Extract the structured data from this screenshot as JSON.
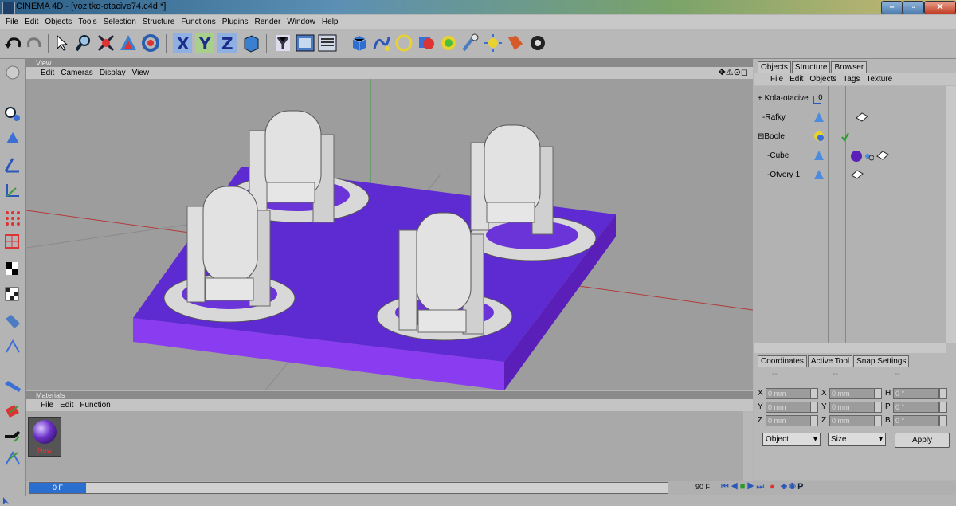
{
  "window": {
    "title": "CINEMA 4D - [vozitko-otacive74.c4d *]",
    "minimize": "–",
    "maximize": "▫",
    "close": "✕"
  },
  "menubar": [
    "File",
    "Edit",
    "Objects",
    "Tools",
    "Selection",
    "Structure",
    "Functions",
    "Plugins",
    "Render",
    "Window",
    "Help"
  ],
  "viewport": {
    "panel_title": "View",
    "menu": [
      "Edit",
      "Cameras",
      "Display",
      "View"
    ],
    "nav_icons": "✥⚠⊙◻"
  },
  "materials": {
    "panel_title": "Materials",
    "menu": [
      "File",
      "Edit",
      "Function"
    ],
    "new_material_label": "New",
    "material_color": "#6a2fc8"
  },
  "objects_panel": {
    "tabs": [
      "Objects",
      "Structure",
      "Browser"
    ],
    "menu": [
      "File",
      "Edit",
      "Objects",
      "Tags",
      "Texture"
    ],
    "tree": [
      {
        "name": "Kola-otacive",
        "prefix": "+"
      },
      {
        "name": "Rafky",
        "prefix": "-"
      },
      {
        "name": "Boole",
        "prefix": "⊟"
      },
      {
        "name": "Cube",
        "prefix": "-"
      },
      {
        "name": "Otvory 1",
        "prefix": "-"
      }
    ]
  },
  "coordinates_panel": {
    "tabs": [
      "Coordinates",
      "Active Tool",
      "Snap Settings"
    ],
    "col_headers": [
      "--",
      "--",
      "--"
    ],
    "rows": [
      {
        "pos_label": "X",
        "pos_value": "0 mm",
        "size_label": "X",
        "size_value": "0 mm",
        "rot_label": "H",
        "rot_value": "0 °"
      },
      {
        "pos_label": "Y",
        "pos_value": "0 mm",
        "size_label": "Y",
        "size_value": "0 mm",
        "rot_label": "P",
        "rot_value": "0 °"
      },
      {
        "pos_label": "Z",
        "pos_value": "0 mm",
        "size_label": "Z",
        "size_value": "0 mm",
        "rot_label": "B",
        "rot_value": "0 °"
      }
    ],
    "mode_select": "Object",
    "size_select": "Size",
    "apply_label": "Apply"
  },
  "timeline": {
    "current_frame": "0 F",
    "end_frame": "90 F"
  },
  "colors": {
    "platform_top": "#5e2ad2",
    "platform_side": "#8a3cf0",
    "grid_red": "#b23a3a",
    "grid_green": "#3b9a3b"
  }
}
